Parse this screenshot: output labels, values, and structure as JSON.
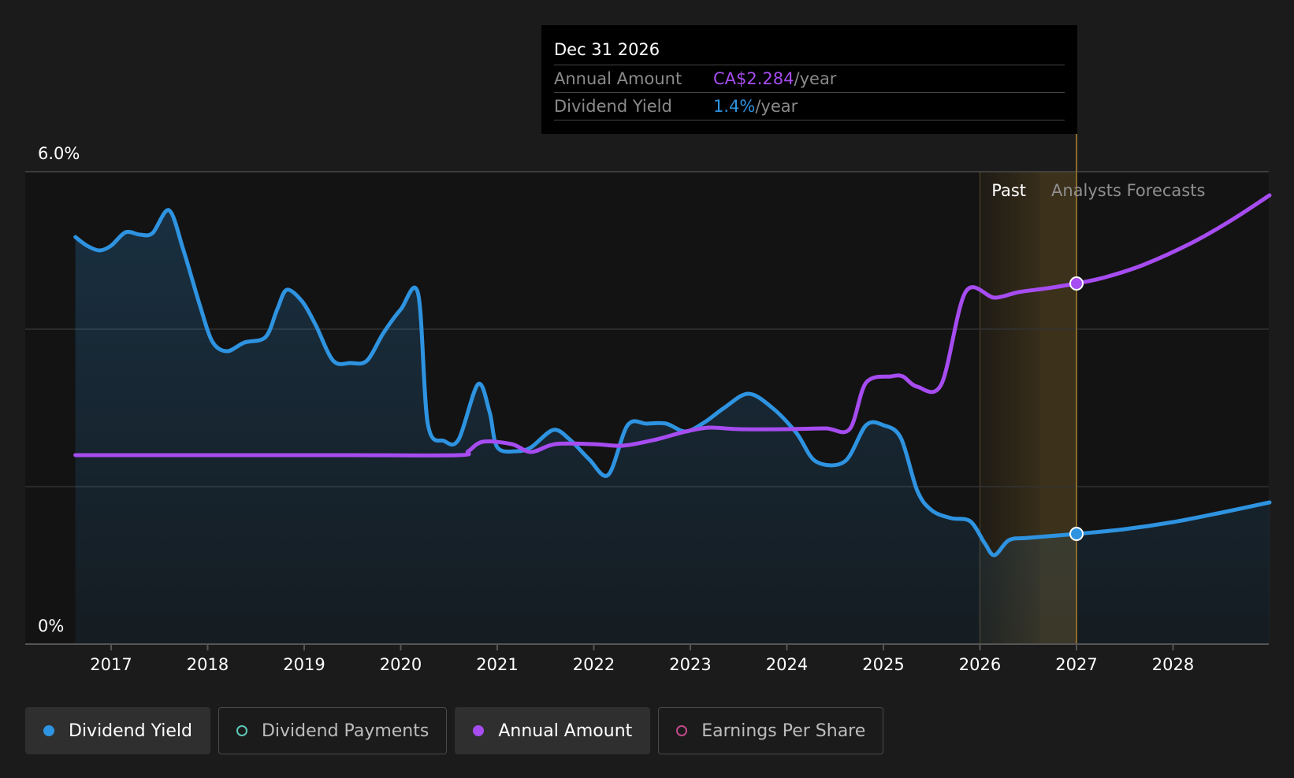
{
  "colors": {
    "background": "#1b1b1b",
    "plot_background": "#131313",
    "dividend_yield": "#2e93e0",
    "annual_amount": "#a64cf0",
    "dividend_payments": "#5ec8b8",
    "earnings_per_share": "#c04a8a",
    "past_highlight": "#8a6a2a"
  },
  "tooltip": {
    "date": "Dec 31 2026",
    "rows": [
      {
        "label": "Annual Amount",
        "value": "CA$2.284",
        "unit": "/year",
        "color": "#a64cf0"
      },
      {
        "label": "Dividend Yield",
        "value": "1.4%",
        "unit": "/year",
        "color": "#2e93e0"
      }
    ]
  },
  "legend": [
    {
      "label": "Dividend Yield",
      "icon": "filled-dot",
      "color": "#2e93e0",
      "active": true
    },
    {
      "label": "Dividend Payments",
      "icon": "hollow-dot",
      "color": "#5ec8b8",
      "active": false
    },
    {
      "label": "Annual Amount",
      "icon": "filled-dot",
      "color": "#a64cf0",
      "active": true
    },
    {
      "label": "Earnings Per Share",
      "icon": "hollow-dot",
      "color": "#c04a8a",
      "active": false
    }
  ],
  "chart_data": {
    "type": "line",
    "ylim": [
      0,
      6.0
    ],
    "y_tick_labels": [
      "0%",
      "6.0%"
    ],
    "y_gridlines": [
      2.0,
      4.0
    ],
    "x_range": [
      2016.3,
      2029.0
    ],
    "x_tick_labels": [
      "2017",
      "2018",
      "2019",
      "2020",
      "2021",
      "2022",
      "2023",
      "2024",
      "2025",
      "2026",
      "2027",
      "2028"
    ],
    "x_ticks": [
      2017,
      2018,
      2019,
      2020,
      2021,
      2022,
      2023,
      2024,
      2025,
      2026,
      2027,
      2028
    ],
    "past_label": "Past",
    "forecast_label": "Analysts Forecasts",
    "past_band": [
      2026.0,
      2027.0
    ],
    "selected_x": 2027.0,
    "series": [
      {
        "name": "Dividend Yield",
        "fill": true,
        "points": [
          [
            2016.63,
            5.17
          ],
          [
            2016.75,
            5.06
          ],
          [
            2016.88,
            5.0
          ],
          [
            2017.0,
            5.06
          ],
          [
            2017.15,
            5.23
          ],
          [
            2017.3,
            5.2
          ],
          [
            2017.43,
            5.22
          ],
          [
            2017.6,
            5.51
          ],
          [
            2017.75,
            5.0
          ],
          [
            2017.92,
            4.3
          ],
          [
            2018.05,
            3.84
          ],
          [
            2018.2,
            3.72
          ],
          [
            2018.38,
            3.83
          ],
          [
            2018.6,
            3.9
          ],
          [
            2018.72,
            4.25
          ],
          [
            2018.82,
            4.5
          ],
          [
            2018.98,
            4.35
          ],
          [
            2019.12,
            4.05
          ],
          [
            2019.3,
            3.6
          ],
          [
            2019.48,
            3.57
          ],
          [
            2019.65,
            3.6
          ],
          [
            2019.82,
            3.95
          ],
          [
            2020.0,
            4.25
          ],
          [
            2020.18,
            4.45
          ],
          [
            2020.28,
            2.8
          ],
          [
            2020.45,
            2.58
          ],
          [
            2020.6,
            2.6
          ],
          [
            2020.8,
            3.3
          ],
          [
            2020.92,
            2.95
          ],
          [
            2021.0,
            2.5
          ],
          [
            2021.2,
            2.45
          ],
          [
            2021.35,
            2.5
          ],
          [
            2021.58,
            2.72
          ],
          [
            2021.75,
            2.6
          ],
          [
            2021.95,
            2.35
          ],
          [
            2022.15,
            2.15
          ],
          [
            2022.35,
            2.78
          ],
          [
            2022.55,
            2.8
          ],
          [
            2022.75,
            2.8
          ],
          [
            2022.95,
            2.7
          ],
          [
            2023.15,
            2.82
          ],
          [
            2023.35,
            3.0
          ],
          [
            2023.6,
            3.18
          ],
          [
            2023.85,
            3.0
          ],
          [
            2024.1,
            2.68
          ],
          [
            2024.3,
            2.32
          ],
          [
            2024.6,
            2.32
          ],
          [
            2024.82,
            2.78
          ],
          [
            2025.0,
            2.78
          ],
          [
            2025.18,
            2.62
          ],
          [
            2025.35,
            1.95
          ],
          [
            2025.5,
            1.7
          ],
          [
            2025.7,
            1.6
          ],
          [
            2025.9,
            1.56
          ],
          [
            2026.05,
            1.28
          ],
          [
            2026.15,
            1.13
          ],
          [
            2026.3,
            1.32
          ],
          [
            2026.5,
            1.35
          ],
          [
            2027.0,
            1.4
          ],
          [
            2027.5,
            1.46
          ],
          [
            2028.0,
            1.55
          ],
          [
            2028.5,
            1.67
          ],
          [
            2029.0,
            1.8
          ]
        ]
      },
      {
        "name": "Annual Amount",
        "fill": false,
        "points": [
          [
            2016.63,
            2.4
          ],
          [
            2017.5,
            2.4
          ],
          [
            2018.5,
            2.4
          ],
          [
            2019.5,
            2.4
          ],
          [
            2020.6,
            2.4
          ],
          [
            2020.7,
            2.45
          ],
          [
            2020.85,
            2.57
          ],
          [
            2021.15,
            2.54
          ],
          [
            2021.35,
            2.44
          ],
          [
            2021.6,
            2.54
          ],
          [
            2022.0,
            2.54
          ],
          [
            2022.3,
            2.52
          ],
          [
            2022.65,
            2.6
          ],
          [
            2022.95,
            2.7
          ],
          [
            2023.2,
            2.75
          ],
          [
            2023.5,
            2.73
          ],
          [
            2024.0,
            2.73
          ],
          [
            2024.4,
            2.74
          ],
          [
            2024.65,
            2.73
          ],
          [
            2024.82,
            3.32
          ],
          [
            2025.08,
            3.4
          ],
          [
            2025.2,
            3.4
          ],
          [
            2025.35,
            3.27
          ],
          [
            2025.6,
            3.3
          ],
          [
            2025.85,
            4.47
          ],
          [
            2026.15,
            4.4
          ],
          [
            2026.4,
            4.47
          ],
          [
            2026.7,
            4.52
          ],
          [
            2027.0,
            4.58
          ],
          [
            2027.3,
            4.66
          ],
          [
            2027.7,
            4.82
          ],
          [
            2028.2,
            5.1
          ],
          [
            2028.6,
            5.38
          ],
          [
            2029.0,
            5.7
          ]
        ]
      }
    ]
  }
}
